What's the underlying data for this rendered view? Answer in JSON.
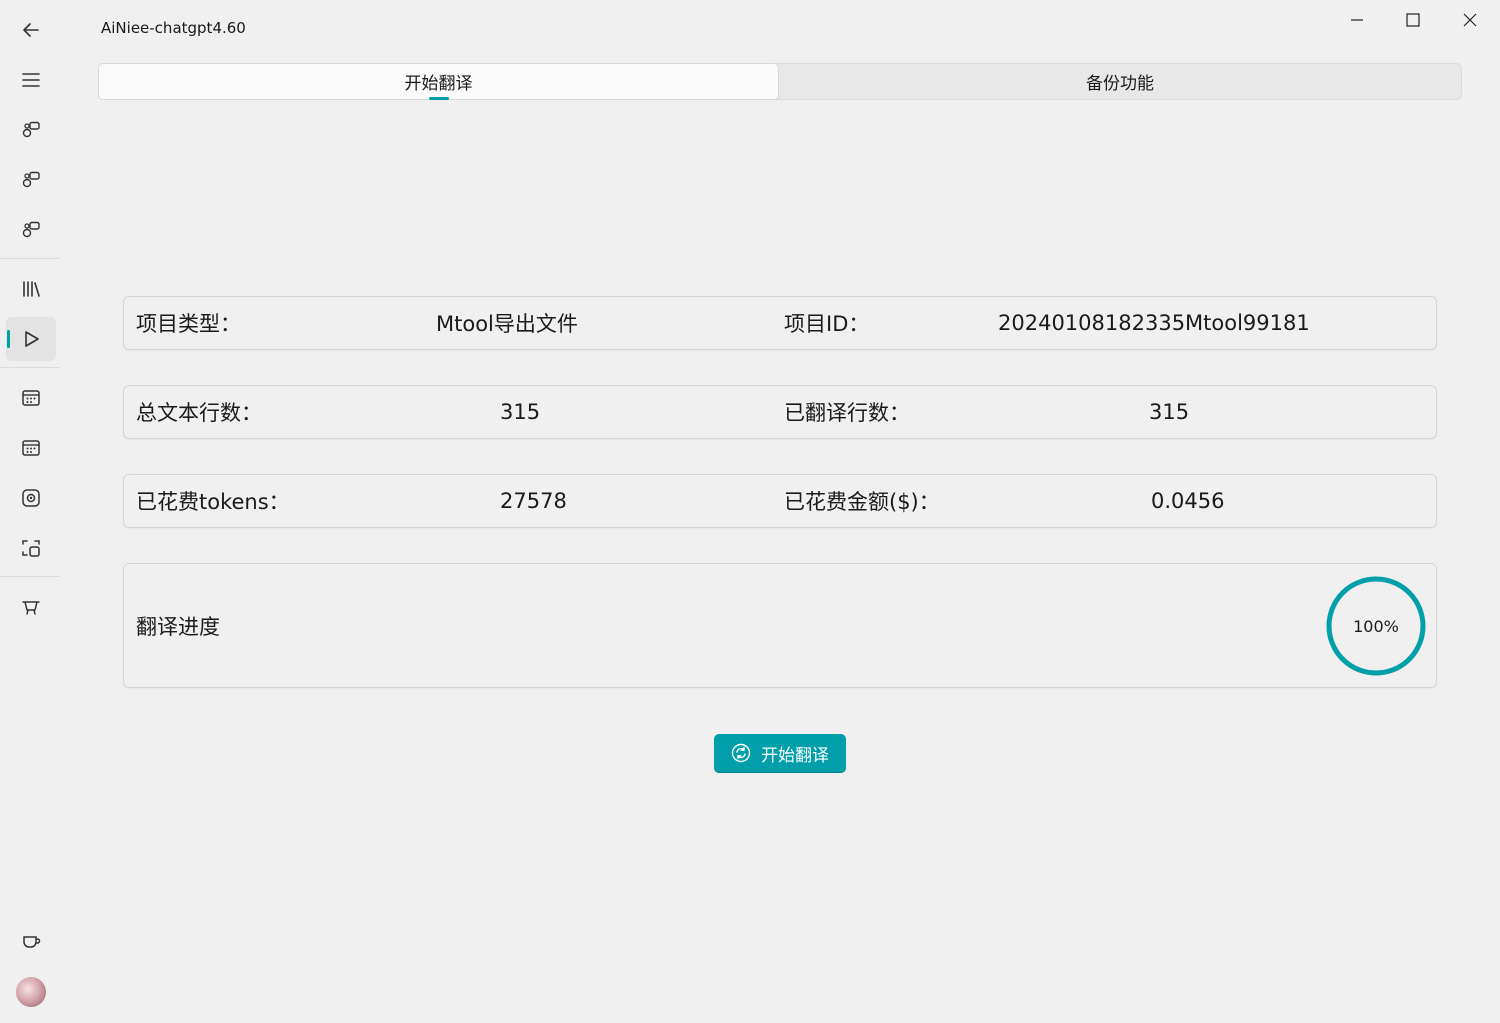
{
  "app": {
    "title": "AiNiee-chatgpt4.60"
  },
  "sidebar": {
    "items": [
      {
        "icon": "arrow-left-icon"
      },
      {
        "icon": "menu-icon"
      },
      {
        "icon": "chat-bubbles-icon"
      },
      {
        "icon": "chat-bubbles-icon"
      },
      {
        "icon": "chat-bubbles-icon"
      },
      {
        "icon": "library-icon"
      },
      {
        "icon": "play-icon",
        "active": true
      },
      {
        "icon": "calendar-icon"
      },
      {
        "icon": "calendar-icon"
      },
      {
        "icon": "target-icon"
      },
      {
        "icon": "scan-icon"
      },
      {
        "icon": "basket-icon"
      },
      {
        "icon": "cup-icon"
      },
      {
        "icon": "avatar"
      }
    ]
  },
  "tabs": [
    {
      "label": "开始翻译",
      "active": true
    },
    {
      "label": "备份功能",
      "active": false
    }
  ],
  "info": {
    "row1": {
      "label_a": "项目类型：",
      "value_a": "Mtool导出文件",
      "label_b": "项目ID：",
      "value_b": "20240108182335Mtool99181"
    },
    "row2": {
      "label_a": "总文本行数：",
      "value_a": "315",
      "label_b": "已翻译行数：",
      "value_b": "315"
    },
    "row3": {
      "label_a": "已花费tokens：",
      "value_a": "27578",
      "label_b": "已花费金额($)：",
      "value_b": "0.0456"
    }
  },
  "progress": {
    "label": "翻译进度",
    "percent_text": "100%",
    "fraction": 1.0
  },
  "start_button": {
    "label": "开始翻译",
    "icon": "sync-icon"
  },
  "colors": {
    "accent": "#009faa",
    "background": "#f0f0f0"
  }
}
